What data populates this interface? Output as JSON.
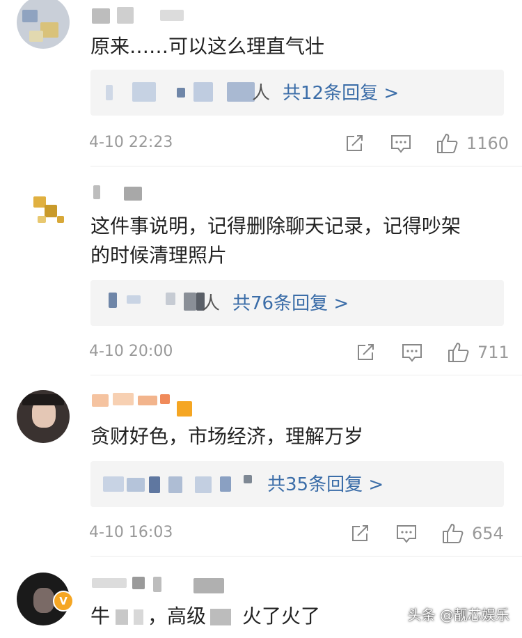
{
  "comments": [
    {
      "text": "原来……可以这么理直气壮",
      "replies_visible": "人",
      "replies_label": "共12条回复 >",
      "time": "4-10 22:23",
      "likes": "1160"
    },
    {
      "text_line1": "这件事说明，记得删除聊天记录，记得吵架",
      "text_line2": "的时候清理照片",
      "replies_visible": "人",
      "replies_label": "共76条回复 >",
      "time": "4-10 20:00",
      "likes": "711"
    },
    {
      "text": "贪财好色，市场经济，理解万岁",
      "replies_label": "共35条回复 >",
      "time": "4-10 16:03",
      "likes": "654"
    },
    {
      "text_a": "牛",
      "text_b": "，高级",
      "text_c": "火了火了",
      "badge": "V"
    }
  ],
  "watermark": "头条 @靓芯娱乐",
  "colors": {
    "link": "#3b6da8",
    "meta": "#999999",
    "reply_bg": "#f4f4f4",
    "badge": "#f5a623"
  }
}
